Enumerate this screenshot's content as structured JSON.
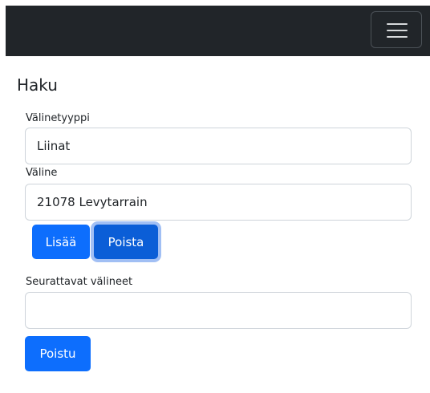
{
  "form": {
    "title": "Haku",
    "equipment_type": {
      "label": "Välinetyyppi",
      "value": "Liinat"
    },
    "equipment": {
      "label": "Väline",
      "value": "21078 Levytarrain"
    },
    "add_button": "Lisää",
    "remove_button": "Poista",
    "tracked": {
      "label": "Seurattavat välineet",
      "value": ""
    },
    "exit_button": "Poistu"
  },
  "colors": {
    "navbar": "#212529",
    "primary": "#0d6efd",
    "primary_focused": "#0b5ed7"
  },
  "icons": {
    "menu": "hamburger-icon"
  }
}
